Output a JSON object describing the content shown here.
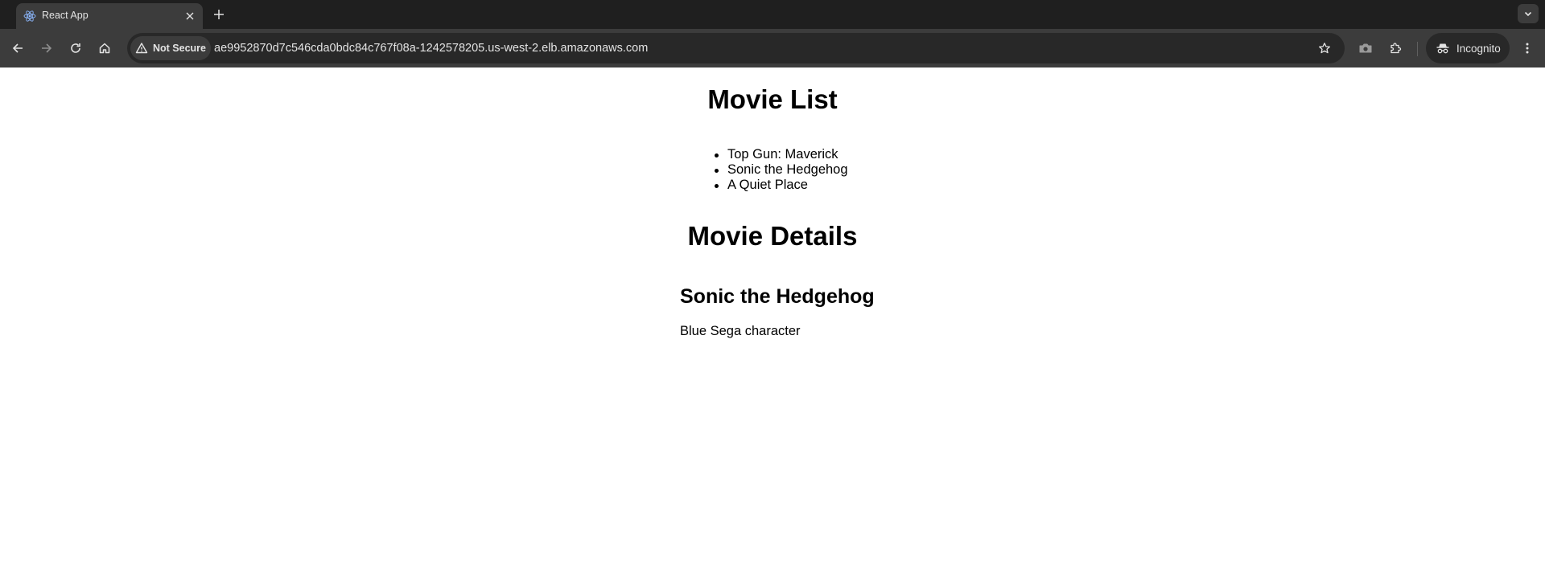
{
  "browser": {
    "tab": {
      "title": "React App",
      "favicon": "react-logo-icon"
    },
    "address_bar": {
      "security_label": "Not Secure",
      "url": "ae9952870d7c546cda0bdc84c767f08a-1242578205.us-west-2.elb.amazonaws.com"
    },
    "profile": {
      "label": "Incognito"
    },
    "colors": {
      "tabstrip": "#1f1f1f",
      "toolbar": "#3c3c3c",
      "omnibox": "#282828",
      "text": "#e3e3e3"
    }
  },
  "page": {
    "list_heading": "Movie List",
    "movies": [
      "Top Gun: Maverick",
      "Sonic the Hedgehog",
      "A Quiet Place"
    ],
    "details_heading": "Movie Details",
    "selected_movie": {
      "title": "Sonic the Hedgehog",
      "description": "Blue Sega character"
    }
  }
}
